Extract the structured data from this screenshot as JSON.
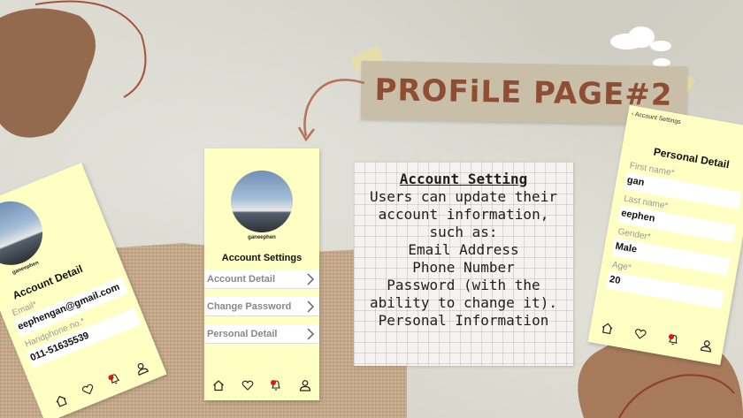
{
  "title": "PROFiLE PAGE#2",
  "info_card": {
    "heading": "Account Setting",
    "lines": [
      "Users can update their",
      "account information,",
      "such as:",
      "Email Address",
      "Phone Number",
      "Password (with the",
      "ability to change it).",
      "Personal Information"
    ]
  },
  "phone_mid": {
    "username": "ganeephen",
    "screen_title": "Account Settings",
    "menu": [
      {
        "label": "Account Detail"
      },
      {
        "label": "Change Password"
      },
      {
        "label": "Personal Detail"
      }
    ]
  },
  "phone_left": {
    "username": "ganeephen",
    "screen_title": "Account Detail",
    "email_label": "Email*",
    "email_value": "eephengan@gmail.com",
    "phone_label": "Handphone no.*",
    "phone_value": "011-51635539"
  },
  "phone_right": {
    "back_label": "‹ Account Settings",
    "screen_title": "Personal Detail",
    "fields": [
      {
        "label": "First name*",
        "value": "gan"
      },
      {
        "label": "Last name*",
        "value": "eephen"
      },
      {
        "label": "Gender*",
        "value": "Male"
      },
      {
        "label": "Age*",
        "value": "20"
      }
    ]
  },
  "icons": [
    "home-icon",
    "heart-icon",
    "notification-bell-icon",
    "profile-icon",
    "chevron-right-icon",
    "arrow-icon"
  ],
  "colors": {
    "phone_bg": "#ffffc4",
    "title_text": "#8e4e34",
    "title_banner": "#c9bfa8",
    "blob": "#946a4f",
    "notification_dot": "#e0141c"
  }
}
